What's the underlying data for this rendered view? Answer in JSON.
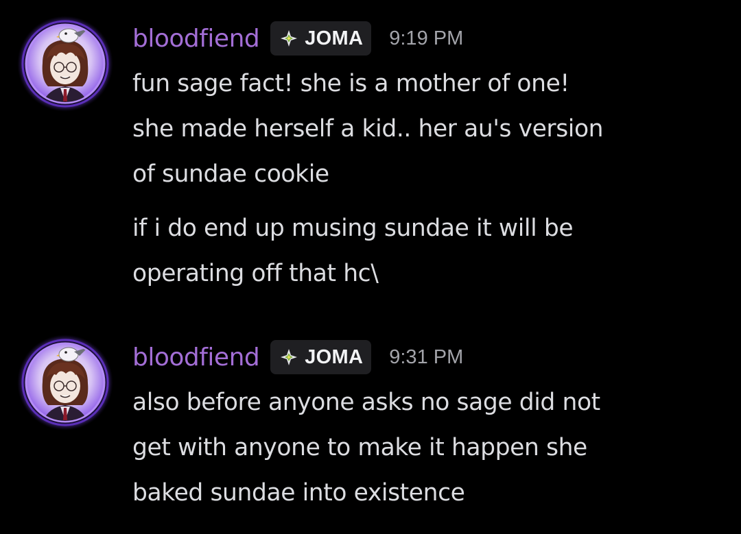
{
  "messages": [
    {
      "username": "bloodfiend",
      "tag": "JOMA",
      "tag_icon": "diamond-sparkle-icon",
      "timestamp": "9:19 PM",
      "paragraphs": [
        [
          "fun sage fact! she is a mother of one!",
          "she made herself a kid.. her au's version",
          "of sundae cookie"
        ],
        [
          "if i do end up musing sundae it will be",
          "operating off that hc\\"
        ]
      ]
    },
    {
      "username": "bloodfiend",
      "tag": "JOMA",
      "tag_icon": "diamond-sparkle-icon",
      "timestamp": "9:31 PM",
      "paragraphs": [
        [
          "also before anyone asks no sage did not",
          "get with anyone to make it happen she",
          "baked sundae into existence"
        ]
      ]
    }
  ],
  "colors": {
    "background": "#000000",
    "username": "#a36ed6",
    "text": "#dcdde1",
    "timestamp": "#a3a4aa",
    "tag_bg": "#1f1f22",
    "avatar_ring": "#9a5cf0"
  }
}
